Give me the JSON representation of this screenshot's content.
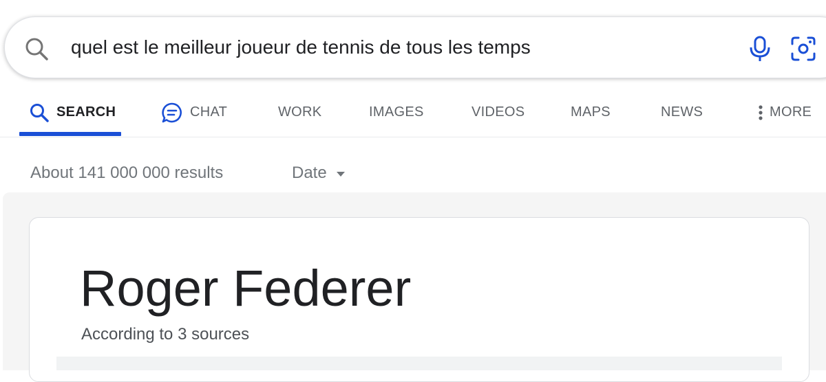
{
  "search": {
    "query": "quel est le meilleur joueur de tennis de tous les temps",
    "left_icon": "search-icon",
    "voice_icon": "mic-icon",
    "lens_icon": "camera-lens-icon"
  },
  "tabs": [
    {
      "label": "SEARCH",
      "icon": "search-icon",
      "active": true
    },
    {
      "label": "CHAT",
      "icon": "chat-bubble-icon",
      "active": false
    },
    {
      "label": "WORK",
      "active": false
    },
    {
      "label": "IMAGES",
      "active": false
    },
    {
      "label": "VIDEOS",
      "active": false
    },
    {
      "label": "MAPS",
      "active": false
    },
    {
      "label": "NEWS",
      "active": false
    },
    {
      "label": "MORE",
      "icon": "vertical-dots-icon",
      "active": false
    }
  ],
  "results": {
    "stats": "About 141 000 000 results",
    "date_filter_label": "Date"
  },
  "answer": {
    "title": "Roger Federer",
    "sources": "According to 3 sources"
  },
  "colors": {
    "accent": "#1a4fd6",
    "text_primary": "#202124",
    "text_secondary": "#70757a"
  }
}
